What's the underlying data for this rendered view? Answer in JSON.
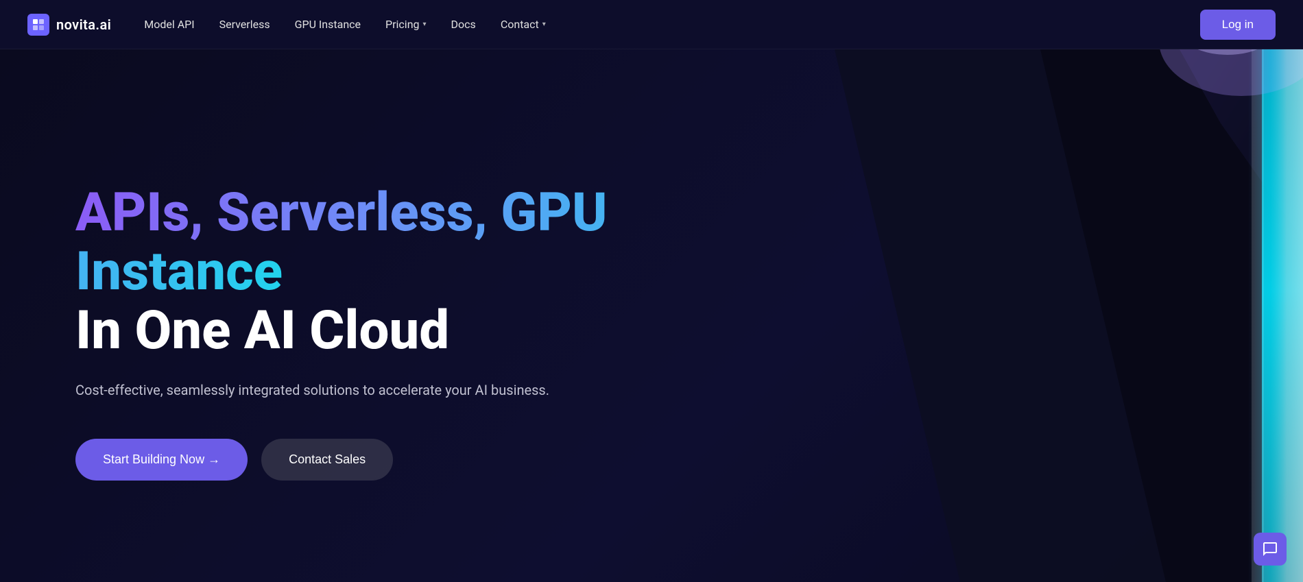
{
  "brand": {
    "name": "novita.ai",
    "logo_icon": "page-icon"
  },
  "navbar": {
    "links": [
      {
        "label": "Model API",
        "has_dropdown": false
      },
      {
        "label": "Serverless",
        "has_dropdown": false
      },
      {
        "label": "GPU Instance",
        "has_dropdown": false
      },
      {
        "label": "Pricing",
        "has_dropdown": true
      },
      {
        "label": "Docs",
        "has_dropdown": false
      },
      {
        "label": "Contact",
        "has_dropdown": true
      }
    ],
    "cta_label": "Log in"
  },
  "hero": {
    "title_gradient": "APIs, Serverless, GPU Instance",
    "title_white": "In One AI Cloud",
    "subtitle": "Cost-effective, seamlessly integrated solutions to accelerate your AI business.",
    "btn_primary": "Start Building Now →",
    "btn_secondary": "Contact Sales"
  },
  "chat": {
    "icon": "chat-icon"
  }
}
